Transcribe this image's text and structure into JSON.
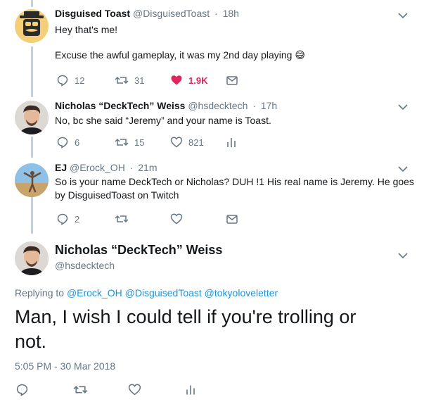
{
  "tweets": [
    {
      "name": "Disguised Toast",
      "handle": "@DisguisedToast",
      "time": "18h",
      "line1": "Hey that's me!",
      "line2": "Excuse the awful gameplay, it was my 2nd day playing",
      "emoji": "😅",
      "replies": "12",
      "retweets": "31",
      "likes": "1.9K"
    },
    {
      "name": "Nicholas “DeckTech” Weiss",
      "handle": "@hsdecktech",
      "time": "17h",
      "text": "No, bc she said “Jeremy” and your name is Toast.",
      "replies": "6",
      "retweets": "15",
      "likes": "821"
    },
    {
      "name": "EJ",
      "handle": "@Erock_OH",
      "time": "21m",
      "line1": "So is your name DeckTech or Nicholas?  DUH !1 His real name is Jeremy. He goes",
      "line2": "by DisguisedToast on Twitch",
      "replies": "2"
    }
  ],
  "focus": {
    "name": "Nicholas “DeckTech” Weiss",
    "handle": "@hsdecktech",
    "replying_label": "Replying to",
    "mentions": [
      "@Erock_OH",
      "@DisguisedToast",
      "@tokyoloveletter"
    ],
    "line1": "Man, I wish I could tell if you're trolling or",
    "line2": "not.",
    "timestamp": "5:05 PM - 30 Mar 2018"
  },
  "separator": "·",
  "icons": [
    "reply-icon",
    "retweet-icon",
    "heart-icon",
    "message-icon",
    "analytics-icon",
    "chevron-down-icon"
  ],
  "colors": {
    "like_red": "#e0245e",
    "link_blue": "#1b95e0",
    "secondary": "#657786",
    "thread_line": "#c4cfd6",
    "toast_avatar_bg": "#f5ce7a"
  }
}
